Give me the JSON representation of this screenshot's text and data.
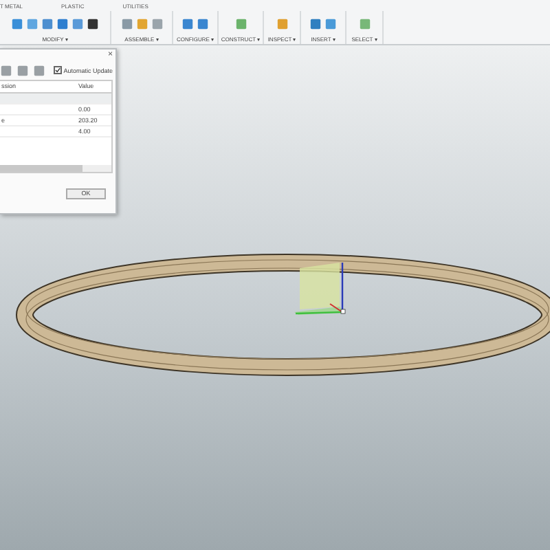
{
  "tabs": [
    {
      "label": "T METAL"
    },
    {
      "label": "PLASTIC"
    },
    {
      "label": "UTILITIES"
    }
  ],
  "groups": [
    {
      "label": "MODIFY ▾"
    },
    {
      "label": "ASSEMBLE ▾"
    },
    {
      "label": "CONFIGURE ▾"
    },
    {
      "label": "CONSTRUCT ▾"
    },
    {
      "label": "INSPECT ▾"
    },
    {
      "label": "INSERT ▾"
    },
    {
      "label": "SELECT ▾"
    }
  ],
  "dialog": {
    "close": "×",
    "auto_update": {
      "label": "Automatic Update",
      "checked": true
    },
    "columns": [
      "ssion",
      "Value"
    ],
    "rows": [
      {
        "value": "0.00"
      },
      {
        "expression": "e",
        "value": "203.20"
      },
      {
        "value": "4.00"
      }
    ],
    "ok": "OK"
  }
}
